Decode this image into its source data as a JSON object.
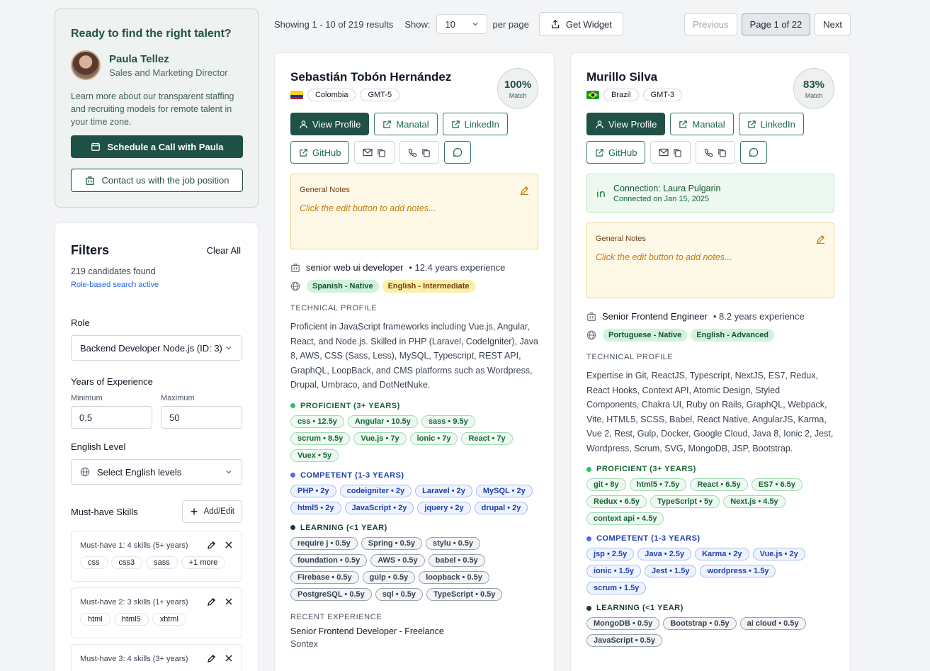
{
  "promo": {
    "heading": "Ready to find the right talent?",
    "rep_name": "Paula Tellez",
    "rep_title": "Sales and Marketing Director",
    "description": "Learn more about our transparent staffing and recruiting models for remote talent in your time zone.",
    "schedule_label": "Schedule a Call with Paula",
    "contact_label": "Contact us with the job position"
  },
  "filters": {
    "title": "Filters",
    "clear_all": "Clear All",
    "found": "219 candidates found",
    "role_active": "Role-based search active",
    "role_label": "Role",
    "role_value": "Backend Developer Node.js (ID: 3)",
    "years_label": "Years of Experience",
    "min_label": "Minimum",
    "min_value": "0,5",
    "max_label": "Maximum",
    "max_value": "50",
    "english_label": "English Level",
    "english_placeholder": "Select English levels",
    "must_label": "Must-have Skills",
    "add_edit": "Add/Edit",
    "must_groups": [
      {
        "title": "Must-have 1: 4 skills (5+ years)",
        "skills": [
          "css",
          "css3",
          "sass",
          "+1 more"
        ]
      },
      {
        "title": "Must-have 2: 3 skills (1+ years)",
        "skills": [
          "html",
          "html5",
          "xhtml"
        ]
      },
      {
        "title": "Must-have 3: 4 skills (3+ years)",
        "skills": []
      }
    ]
  },
  "topbar": {
    "showing": "Showing 1 - 10 of 219 results",
    "show_label": "Show:",
    "show_value": "10",
    "per_page": "per page",
    "widget": "Get Widget",
    "previous": "Previous",
    "page": "Page 1 of 22",
    "next": "Next"
  },
  "labels": {
    "view_profile": "View Profile",
    "manatal": "Manatal",
    "linkedin": "LinkedIn",
    "github": "GitHub",
    "general_notes": "General Notes",
    "notes_placeholder": "Click the edit button to add notes...",
    "technical_profile": "TECHNICAL PROFILE",
    "proficient": "PROFICIENT (3+ YEARS)",
    "competent": "COMPETENT (1-3 YEARS)",
    "learning": "LEARNING (<1 YEAR)",
    "recent_experience": "RECENT EXPERIENCE",
    "match": "Match"
  },
  "candidates": [
    {
      "name": "Sebastián Tobón Hernández",
      "country": "Colombia",
      "timezone": "GMT-5",
      "match": "100%",
      "role": "senior web ui developer",
      "experience": "• 12.4 years experience",
      "languages": [
        {
          "text": "Spanish - Native",
          "level": "native"
        },
        {
          "text": "English - Intermediate",
          "level": "intermediate"
        }
      ],
      "tech": "Proficient in JavaScript frameworks including Vue.js, Angular, React, and Node.js. Skilled in PHP (Laravel, CodeIgniter), Java 8, AWS, CSS (Sass, Less), MySQL, Typescript, REST API, GraphQL, LoopBack, and CMS platforms such as Wordpress, Drupal, Umbraco, and DotNetNuke.",
      "proficient": [
        "css • 12.5y",
        "Angular • 10.5y",
        "sass • 9.5y",
        "scrum • 8.5y",
        "Vue.js • 7y",
        "ionic • 7y",
        "React • 7y",
        "Vuex • 5y"
      ],
      "competent": [
        "PHP • 2y",
        "codeigniter • 2y",
        "Laravel • 2y",
        "MySQL • 2y",
        "html5 • 2y",
        "JavaScript • 2y",
        "jquery • 2y",
        "drupal • 2y"
      ],
      "learning": [
        "require j • 0.5y",
        "Spring • 0.5y",
        "stylu • 0.5y",
        "foundation • 0.5y",
        "AWS • 0.5y",
        "babel • 0.5y",
        "Firebase • 0.5y",
        "gulp • 0.5y",
        "loopback • 0.5y",
        "PostgreSQL • 0.5y",
        "sql • 0.5y",
        "TypeScript • 0.5y"
      ],
      "recent_title": "Senior Frontend Developer - Freelance",
      "recent_company": "Sontex"
    },
    {
      "name": "Murillo Silva",
      "country": "Brazil",
      "timezone": "GMT-3",
      "match": "83%",
      "connection_title": "Connection: Laura Pulgarin",
      "connection_date": "Connected on Jan 15, 2025",
      "role": "Senior Frontend Engineer",
      "experience": "• 8.2 years experience",
      "languages": [
        {
          "text": "Portuguese - Native",
          "level": "native"
        },
        {
          "text": "English - Advanced",
          "level": "advanced"
        }
      ],
      "tech": "Expertise in Git, ReactJS, Typescript, NextJS, ES7, Redux, React Hooks, Context API, Atomic Design, Styled Components, Chakra UI, Ruby on Rails, GraphQL, Webpack, Vite, HTML5, SCSS, Babel, React Native, AngularJS, Karma, Vue 2, Rest, Gulp, Docker, Google Cloud, Java 8, Ionic 2, Jest, Wordpress, Scrum, SVG, MongoDB, JSP, Bootstrap.",
      "proficient": [
        "git • 8y",
        "html5 • 7.5y",
        "React • 6.5y",
        "ES7 • 6.5y",
        "Redux • 6.5y",
        "TypeScript • 5y",
        "Next.js • 4.5y",
        "context api • 4.5y"
      ],
      "competent": [
        "jsp • 2.5y",
        "Java • 2.5y",
        "Karma • 2y",
        "Vue.js • 2y",
        "ionic • 1.5y",
        "Jest • 1.5y",
        "wordpress • 1.5y",
        "scrum • 1.5y"
      ],
      "learning": [
        "MongoDB • 0.5y",
        "Bootstrap • 0.5y",
        "ai cloud • 0.5y",
        "JavaScript • 0.5y"
      ]
    }
  ],
  "colors": {
    "primary": "#1f5147",
    "proficient": "#22c55e",
    "competent": "#4f6bed",
    "learning": "#1f3d36"
  }
}
